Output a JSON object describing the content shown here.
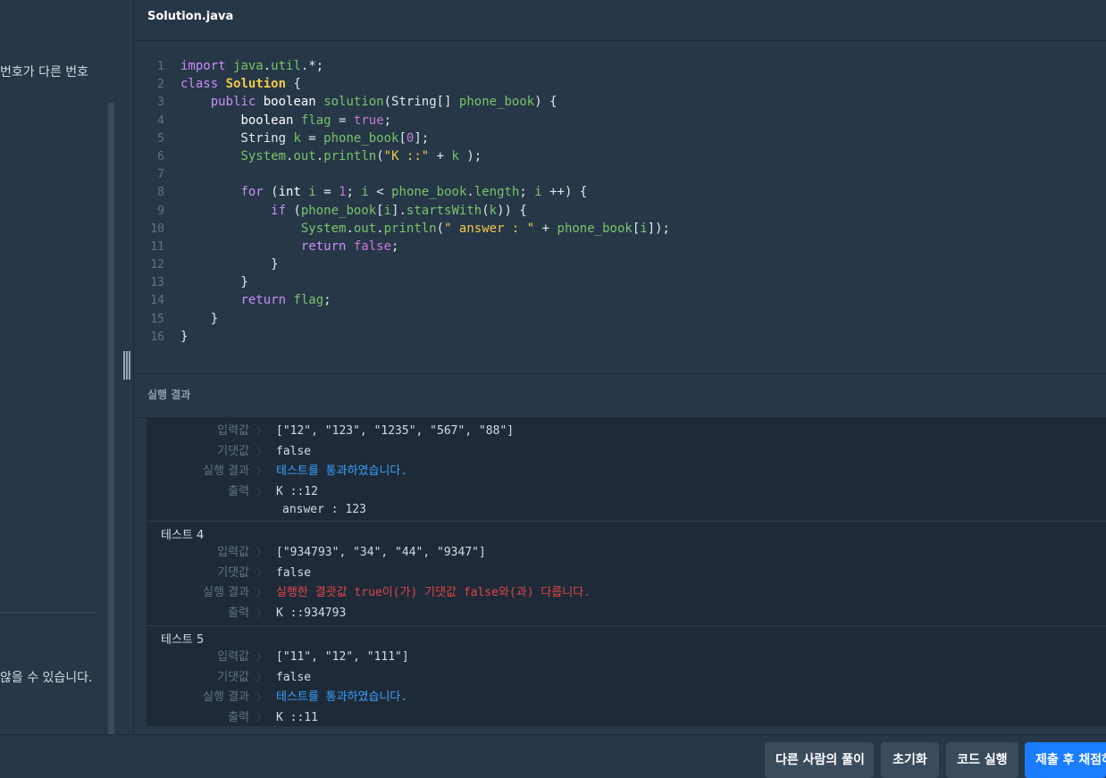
{
  "left_panel": {
    "fragment_top": "번호가 다른 번호",
    "fragment_bottom": "않을 수 있습니다."
  },
  "editor": {
    "tab_title": "Solution.java",
    "line_numbers": [
      "1",
      "2",
      "3",
      "4",
      "5",
      "6",
      "7",
      "8",
      "9",
      "10",
      "11",
      "12",
      "13",
      "14",
      "15",
      "16"
    ]
  },
  "result": {
    "header": "실행 결과",
    "labels": {
      "input": "입력값",
      "expected": "기댓값",
      "result": "실행 결과",
      "output": "출력"
    },
    "tests": [
      {
        "title": "",
        "input": "[\"12\", \"123\", \"1235\", \"567\", \"88\"]",
        "expected": "false",
        "result": "테스트를 통과하였습니다.",
        "output": [
          "K ::12",
          "answer : 123"
        ]
      },
      {
        "title": "테스트 4",
        "input": "[\"934793\", \"34\", \"44\", \"9347\"]",
        "expected": "false",
        "result": "실행한 결괏값 true이(가) 기댓값 false와(과) 다릅니다.",
        "output": [
          "K ::934793"
        ]
      },
      {
        "title": "테스트 5",
        "input": "[\"11\", \"12\", \"111\"]",
        "expected": "false",
        "result": "테스트를 통과하였습니다.",
        "output": [
          "K ::11"
        ]
      }
    ]
  },
  "buttons": {
    "others_solution": "다른 사람의 풀이",
    "reset": "초기화",
    "run": "코드 실행",
    "submit": "제출 후 채점하기"
  },
  "colors": {
    "background": "#263747",
    "result_bg": "#1e2a37",
    "pass": "#3aa0ff",
    "fail": "#e0454b",
    "primary_button": "#1a7cff"
  }
}
